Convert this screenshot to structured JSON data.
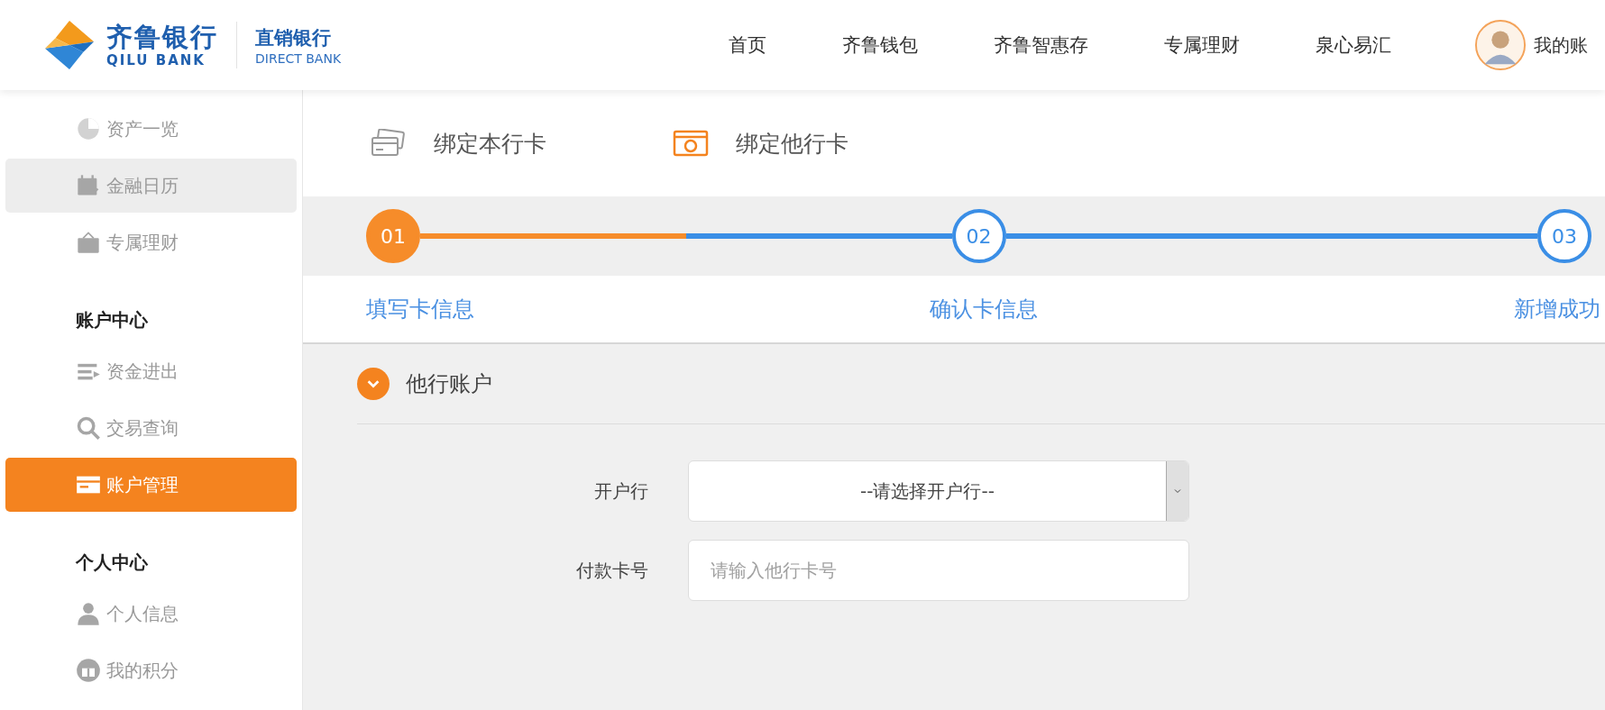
{
  "header": {
    "logo": {
      "name": "齐鲁银行",
      "latin": "QILU BANK",
      "sub_name": "直销银行",
      "sub_latin": "DIRECT BANK"
    },
    "nav": [
      {
        "label": "首页"
      },
      {
        "label": "齐鲁钱包"
      },
      {
        "label": "齐鲁智惠存"
      },
      {
        "label": "专属理财"
      },
      {
        "label": "泉心易汇"
      }
    ],
    "account": {
      "label": "我的账"
    }
  },
  "sidebar": {
    "groups": [
      {
        "items": [
          {
            "label": "资产一览",
            "selected": false,
            "hovered": false
          },
          {
            "label": "金融日历",
            "selected": false,
            "hovered": true
          },
          {
            "label": "专属理财",
            "selected": false,
            "hovered": false
          }
        ]
      },
      {
        "heading": "账户中心",
        "items": [
          {
            "label": "资金进出",
            "selected": false,
            "hovered": false
          },
          {
            "label": "交易查询",
            "selected": false,
            "hovered": false
          },
          {
            "label": "账户管理",
            "selected": true,
            "hovered": false
          }
        ]
      },
      {
        "heading": "个人中心",
        "items": [
          {
            "label": "个人信息",
            "selected": false,
            "hovered": false
          },
          {
            "label": "我的积分",
            "selected": false,
            "hovered": false
          }
        ]
      }
    ]
  },
  "tabs": [
    {
      "label": "绑定本行卡",
      "selected": false
    },
    {
      "label": "绑定他行卡",
      "selected": true
    }
  ],
  "steps": [
    {
      "number": "01",
      "label": "填写卡信息",
      "current": true
    },
    {
      "number": "02",
      "label": "确认卡信息",
      "current": false
    },
    {
      "number": "03",
      "label": "新增成功",
      "current": false
    }
  ],
  "section": {
    "title": "他行账户",
    "expanded": true
  },
  "form": {
    "fields": [
      {
        "kind": "select",
        "label": "开户行",
        "value": "--请选择开户行--"
      },
      {
        "kind": "input",
        "label": "付款卡号",
        "placeholder": "请输入他行卡号"
      }
    ]
  }
}
